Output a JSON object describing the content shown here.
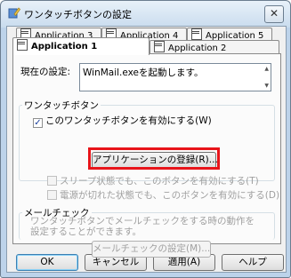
{
  "window": {
    "title": "ワンタッチボタンの設定",
    "close_symbol": "✕",
    "icons": {
      "title": "app-pencil-icon",
      "close": "close-icon"
    }
  },
  "tabs": [
    {
      "label": "Application 3",
      "icon": "app-icon",
      "active": false
    },
    {
      "label": "Application 4",
      "icon": "app-icon",
      "active": false
    },
    {
      "label": "Application 5",
      "icon": "app-icon",
      "active": false
    },
    {
      "label": "Application 1",
      "icon": "app-icon",
      "active": true
    },
    {
      "label": "Application 2",
      "icon": "app-icon",
      "active": false
    }
  ],
  "current_setting": {
    "label": "現在の設定:",
    "value": "WinMail.exeを起動します。"
  },
  "onetouch_group": {
    "title": "ワンタッチボタン",
    "enable_checkbox": {
      "label": "このワンタッチボタンを有効にする(W)",
      "checked": true,
      "check_symbol": "✓"
    },
    "register_button": "アプリケーションの登録(R)...",
    "sleep_checkbox": {
      "label": "スリープ状態でも、このボタンを有効にする(T)",
      "checked": false
    },
    "poweroff_checkbox": {
      "label": "電源が切れた状態でも、このボタンを有効にする(D)",
      "checked": false
    }
  },
  "mailcheck_group": {
    "title": "メールチェック",
    "description": "ワンタッチボタンでメールチェックをする時の動作を設定することができます。",
    "settings_button": "メールチェックの設定(M)..."
  },
  "footer": {
    "ok": "OK",
    "cancel": "キャンセル",
    "apply": "適用(A)",
    "help": "ヘルプ"
  },
  "colors": {
    "highlight": "#e8141a",
    "window_frame": "#bdd3ea"
  }
}
